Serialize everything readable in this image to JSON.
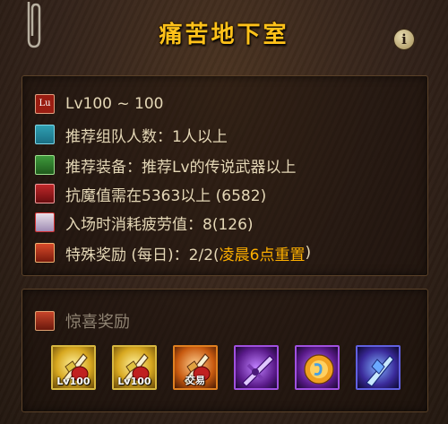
{
  "title": "痛苦地下室",
  "info_icon": "ⅰ",
  "rows": [
    {
      "icon": "level-icon",
      "icon_text": "Lu",
      "text": "Lv100 ~ 100",
      "highlight": ""
    },
    {
      "icon": "party-icon",
      "text": "推荐组队人数：1人以上",
      "highlight": ""
    },
    {
      "icon": "sword-icon",
      "text": "推荐装备：推荐Lv的传说武器以上",
      "highlight": ""
    },
    {
      "icon": "resistance-icon",
      "text": "抗魔值需在5363以上 (6582)",
      "highlight": ""
    },
    {
      "icon": "fatigue-icon",
      "text": "入场时消耗疲劳值：8(126)",
      "highlight": ""
    },
    {
      "icon": "chest-icon",
      "text": "特殊奖励 (每日)：2/2(",
      "highlight": "凌晨6点重置",
      "tail": ")"
    }
  ],
  "reward": {
    "heading": "惊喜奖励",
    "items": [
      {
        "name": "weapon-box-icon",
        "tag": "Lv100",
        "rarity_color": "#d8b840"
      },
      {
        "name": "weapon-box-icon",
        "tag": "Lv100",
        "rarity_color": "#d8b840"
      },
      {
        "name": "weapon-box-icon",
        "tag": "交易",
        "rarity_color": "#e08020"
      },
      {
        "name": "purple-sword-icon",
        "tag": "",
        "rarity_color": "#a050e0"
      },
      {
        "name": "orb-icon",
        "tag": "",
        "rarity_color": "#a050e0"
      },
      {
        "name": "crystal-shard-icon",
        "tag": "",
        "rarity_color": "#6060e0"
      }
    ]
  },
  "colors": {
    "title": "#ffc21a",
    "text": "#e4d7b6",
    "highlight": "#ffb000",
    "muted": "#8f8372"
  }
}
